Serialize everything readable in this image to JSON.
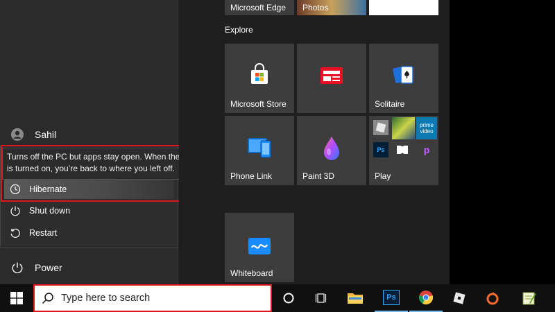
{
  "left_panel": {
    "user_name": "Sahil",
    "power_label": "Power",
    "power_menu": {
      "tooltip": "Turns off the PC but apps stay open. When the PC is turned on, you’re back to where you left off.",
      "items": [
        {
          "label": "Hibernate",
          "icon": "clock-icon"
        },
        {
          "label": "Shut down",
          "icon": "power-icon"
        },
        {
          "label": "Restart",
          "icon": "restart-icon"
        }
      ]
    }
  },
  "tiles": {
    "top_row": {
      "label": "Microsoft Edge",
      "photos_label": "Photos"
    },
    "group_title": "Explore",
    "items": [
      {
        "label": "Microsoft Store",
        "icon": "store-icon"
      },
      {
        "label": "",
        "icon": "news-icon"
      },
      {
        "label": "Solitaire",
        "icon": "cards-icon"
      },
      {
        "label": "Phone Link",
        "icon": "phone-link-icon"
      },
      {
        "label": "Paint 3D",
        "icon": "paint3d-icon"
      },
      {
        "label": "Play",
        "icon": "play-folder-icon"
      },
      {
        "label": "Whiteboard",
        "icon": "whiteboard-icon"
      }
    ],
    "play_folder": {
      "prime_text": "prime video"
    }
  },
  "taskbar": {
    "search_placeholder": "Type here to search",
    "apps": [
      "cortana-icon",
      "task-view-icon",
      "file-explorer-icon",
      "photoshop-icon",
      "chrome-icon",
      "roblox-icon",
      "origin-icon",
      "notepad-plus-icon"
    ],
    "ps_text": "Ps"
  },
  "colors": {
    "highlight": "#e0161e",
    "tile": "#3d3d3d",
    "panel": "#2b2b2b",
    "accent_blue": "#0078d4"
  }
}
